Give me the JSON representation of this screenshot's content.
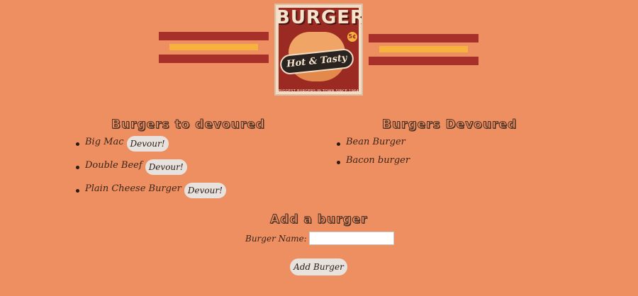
{
  "colors": {
    "background": "#ee8f62",
    "stripe_red": "#a8302a",
    "stripe_yellow": "#f6b13f",
    "button_bg": "#e7e2de"
  },
  "logo": {
    "title": "BURGERS",
    "price_badge": "5¢",
    "tagline": "Hot & Tasty",
    "footer": "BIGGEST BURGERS IN TOWN SINCE 1964"
  },
  "undevoured": {
    "heading": "Burgers to devoured",
    "items": [
      {
        "name": "Big Mac",
        "button_label": "Devour!"
      },
      {
        "name": "Double Beef",
        "button_label": "Devour!"
      },
      {
        "name": "Plain Cheese Burger",
        "button_label": "Devour!"
      }
    ]
  },
  "devoured": {
    "heading": "Burgers Devoured",
    "items": [
      {
        "name": "Bean Burger"
      },
      {
        "name": "Bacon burger"
      }
    ]
  },
  "add_form": {
    "heading": "Add a burger",
    "label": "Burger Name:",
    "input_value": "",
    "submit_label": "Add Burger"
  }
}
